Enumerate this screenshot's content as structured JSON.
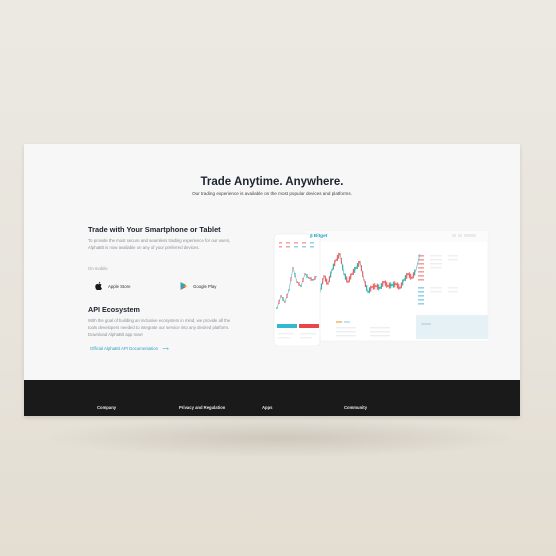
{
  "hero": {
    "title": "Trade Anytime. Anywhere.",
    "subtitle": "Our trading experience is available on the most popular devices and platforms."
  },
  "mobile": {
    "title": "Trade with Your Smartphone or Tablet",
    "description": "To provide the most secure and seamless trading experience for our users, AlphaBit is now available on any of your preferred devices.",
    "available_label": "On mobile",
    "apple_store": "Apple Store",
    "google_play": "Google Play"
  },
  "api": {
    "title": "API Ecosystem",
    "description": "With the goal of building an inclusive ecosystem in mind, we provide all the tools developers needed to integrate our service into any desired platform. Download AlphaBit app now!",
    "link": "Official AlphaBit API Documentation"
  },
  "mockup": {
    "brand": "Bitget"
  },
  "footer": {
    "company": "Company",
    "privacy": "Privacy and Regulation",
    "apps": "Apps",
    "community": "Community"
  },
  "colors": {
    "accent": "#2ea0c6",
    "up": "#26a69a",
    "down": "#ef5350"
  },
  "icons": [
    "apple-icon",
    "google-play-icon",
    "arrow-right-icon"
  ]
}
